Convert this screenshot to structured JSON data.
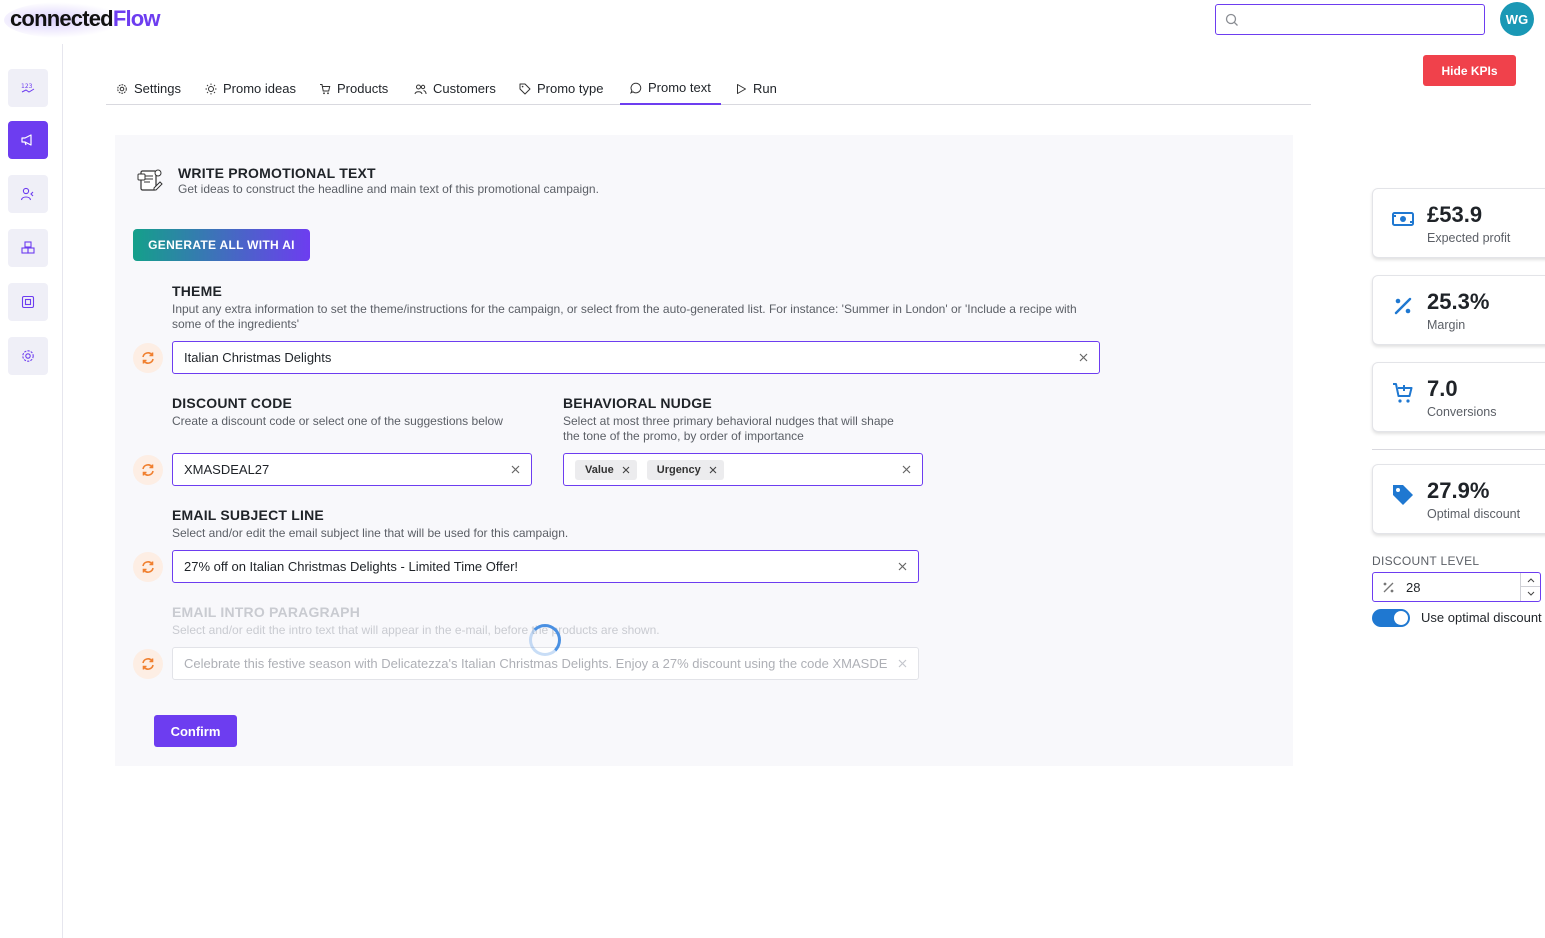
{
  "app": {
    "logo_prefix": "connected",
    "logo_suffix": "Flow",
    "avatar_initials": "WG",
    "search_placeholder": ""
  },
  "actions": {
    "hide_kpis": "Hide KPIs",
    "generate_all": "GENERATE ALL WITH AI",
    "confirm": "Confirm"
  },
  "tabs": [
    {
      "label": "Settings",
      "icon": "gear-icon"
    },
    {
      "label": "Promo ideas",
      "icon": "lightbulb-icon"
    },
    {
      "label": "Products",
      "icon": "cart-icon"
    },
    {
      "label": "Customers",
      "icon": "users-icon"
    },
    {
      "label": "Promo type",
      "icon": "tag-icon"
    },
    {
      "label": "Promo text",
      "icon": "chat-icon",
      "active": true
    },
    {
      "label": "Run",
      "icon": "play-icon"
    }
  ],
  "main": {
    "title": "WRITE PROMOTIONAL TEXT",
    "subtitle": "Get ideas to construct the headline and main text of this promotional campaign.",
    "theme": {
      "title": "THEME",
      "desc": "Input any extra information to set the theme/instructions for the campaign, or select from the auto-generated list. For instance: 'Summer in London' or 'Include a recipe with some of the ingredients'",
      "value": "Italian Christmas Delights"
    },
    "discount_code": {
      "title": "DISCOUNT CODE",
      "desc": "Create a discount code or select one of the suggestions below",
      "value": "XMASDEAL27"
    },
    "nudge": {
      "title": "BEHAVIORAL NUDGE",
      "desc": "Select at most three primary behavioral nudges that will shape the tone of the promo, by order of importance",
      "chips": [
        "Value",
        "Urgency"
      ]
    },
    "subject": {
      "title": "EMAIL SUBJECT LINE",
      "desc": "Select and/or edit the email subject line that will be used for this campaign.",
      "value": "27% off on Italian Christmas Delights - Limited Time Offer!"
    },
    "intro": {
      "title": "EMAIL INTRO PARAGRAPH",
      "desc": "Select and/or edit the intro text that will appear in the e-mail, before the products are shown.",
      "value": "Celebrate this festive season with Delicatezza's Italian Christmas Delights. Enjoy a 27% discount using the code XMASDE"
    }
  },
  "kpis": [
    {
      "value": "£53.9",
      "label": "Expected profit",
      "icon": "money-icon"
    },
    {
      "value": "25.3%",
      "label": "Margin",
      "icon": "percent-icon"
    },
    {
      "value": "7.0",
      "label": "Conversions",
      "icon": "cart-add-icon"
    },
    {
      "value": "27.9%",
      "label": "Optimal discount",
      "icon": "tag-icon"
    }
  ],
  "discount_level": {
    "label": "DISCOUNT LEVEL",
    "value": "28",
    "toggle_label": "Use optimal discount",
    "toggle_on": true
  },
  "colors": {
    "accent": "#6d3df0",
    "danger": "#f0414b",
    "kpi_icon": "#1f78d1",
    "regen": "#f07f2e"
  }
}
